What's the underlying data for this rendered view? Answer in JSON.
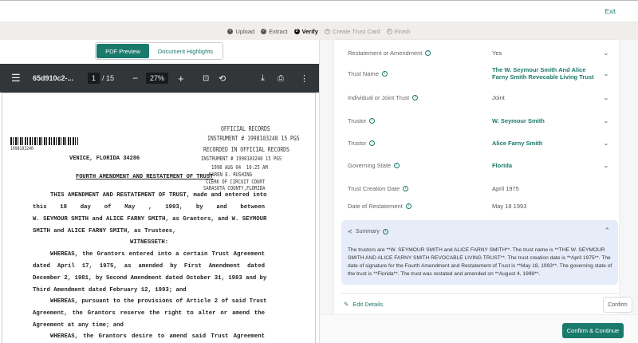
{
  "header": {
    "exit": "Exit"
  },
  "steps": [
    {
      "label": "Upload",
      "num": "✓"
    },
    {
      "label": "Extract",
      "num": "✓"
    },
    {
      "label": "Verify",
      "num": "3"
    },
    {
      "label": "Create Trust Card",
      "num": "4"
    },
    {
      "label": "Finish",
      "num": "5"
    }
  ],
  "tabs": {
    "pdf": "PDF Preview",
    "highlights": "Document Highlights"
  },
  "pdf": {
    "filename": "65d910c2-...",
    "page": "1",
    "total": "/ 15",
    "zoom": "27%",
    "lines": [
      "THIS AMENDMENT AND RESTATEMENT OF TRUST, made and entered into",
      "this  18  day of  May      , 1993, by and between",
      "W. SEYMOUR SMITH and ALICE FARNY SMITH, as Grantors, and W. SEYMOUR",
      "SMITH and ALICE FARNY SMITH, as Trustees,",
      "WITNESSETH:",
      "    WHEREAS, the Grantors entered into a certain Trust Agreement",
      "dated April 17, 1975, as amended by First Amendment dated",
      "December 2, 1981, by Second Amendment dated October 31, 1983 and by",
      "Third Amendment dated February 12, 1993; and",
      "    WHEREAS, pursuant to the provisions of Article 2 of said Trust",
      "Agreement, the Grantors reserve the right to alter or amend the",
      "Agreement at any time; and",
      "    WHEREAS, the Grantors desire to amend said Trust Agreement"
    ],
    "heading": "FOURTH AMENDMENT AND RESTATEMENT OF TRUST",
    "address": "VENICE, FLORIDA 34286",
    "barcode_num": "1998103240",
    "stamps": [
      "OFFICIAL RECORDS",
      "INSTRUMENT # 1998103240 15 PGS",
      "RECORDED IN OFFICIAL RECORDS",
      "INSTRUMENT # 1998103240 15 PGS",
      "1998 AUG 04  10:25 AM",
      "KAREN E. RUSHING",
      "CLERK OF CIRCUIT COURT",
      "SARASOTA COUNTY,FLORIDA"
    ]
  },
  "fields": [
    {
      "label": "Restatement or Amendment",
      "value": "Yes",
      "hl": false,
      "chev": true
    },
    {
      "label": "Trust Name",
      "value": "The W. Seymour Smith And Alice Farny Smith Revocable Living Trust",
      "hl": true,
      "chev": true
    },
    {
      "label": "Individual or Joint Trust",
      "value": "Joint",
      "hl": false,
      "chev": true
    },
    {
      "label": "Trustor",
      "value": "W. Seymour Smith",
      "hl": true,
      "chev": true
    },
    {
      "label": "Trustor",
      "value": "Alice Farny Smith",
      "hl": true,
      "chev": true
    },
    {
      "label": "Governing State",
      "value": "Florida",
      "hl": true,
      "chev": true
    },
    {
      "label": "Trust Creation Date",
      "value": "April 1975",
      "hl": false,
      "chev": false
    },
    {
      "label": "Date of Restatement",
      "value": "May 18 1993",
      "hl": false,
      "chev": false
    }
  ],
  "summary": {
    "title": "Summary",
    "text": "The trustors are **W. SEYMOUR SMITH and ALICE FARNY SMITH**. The trust name is **THE W. SEYMOUR SMITH AND ALICE FARNY SMITH REVOCABLE LIVING TRUST**. The trust creation date is **April 1975**. The date of signature for the Fourth Amendment and Restatement of Trust is **May 18, 1993**. The governing state of the trust is **Florida**. The trust was restated and amended on **August 4, 1998**."
  },
  "actions": {
    "edit": "Edit Details",
    "confirm": "Confirm",
    "confirm_continue": "Confirm & Continue"
  }
}
